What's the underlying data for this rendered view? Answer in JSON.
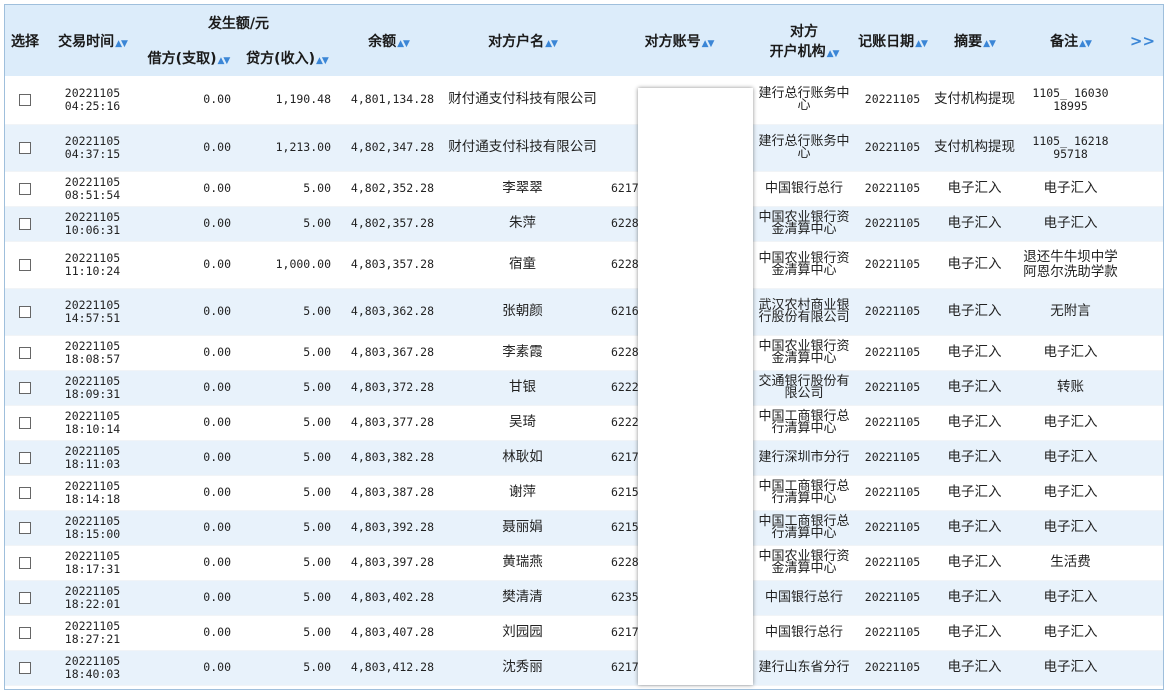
{
  "headers": {
    "select": "选择",
    "trans_time": "交易时间",
    "amount_group": "发生额/元",
    "debit": "借方(支取)",
    "credit": "贷方(收入)",
    "balance": "余额",
    "cp_name": "对方户名",
    "cp_account": "对方账号",
    "cp_bank_line1": "对方",
    "cp_bank_line2": "开户机构",
    "post_date": "记账日期",
    "summary": "摘要",
    "remark": "备注",
    "next_icon": "double-chevron-right-icon",
    "next_label": ">>",
    "sort_icon": "sort-arrows-icon",
    "sort_glyph": "▲▼"
  },
  "colors": {
    "header_bg": "#dcecfa",
    "stripe_bg": "#e8f2fb",
    "accent": "#3b86d6"
  },
  "rows": [
    {
      "date": "20221105",
      "time": "04:25:16",
      "debit": "0.00",
      "credit": "1,190.48",
      "balance": "4,801,134.28",
      "name": "财付通支付科技有限公司",
      "account": "",
      "bank": "建行总行账务中心",
      "post": "20221105",
      "summary": "支付机构提现",
      "remark": "1105_ 16030 18995"
    },
    {
      "date": "20221105",
      "time": "04:37:15",
      "debit": "0.00",
      "credit": "1,213.00",
      "balance": "4,802,347.28",
      "name": "财付通支付科技有限公司",
      "account": "",
      "bank": "建行总行账务中心",
      "post": "20221105",
      "summary": "支付机构提现",
      "remark": "1105_ 16218 95718"
    },
    {
      "date": "20221105",
      "time": "08:51:54",
      "debit": "0.00",
      "credit": "5.00",
      "balance": "4,802,352.28",
      "name": "李翠翠",
      "account": "6217",
      "bank": "中国银行总行",
      "post": "20221105",
      "summary": "电子汇入",
      "remark": "电子汇入"
    },
    {
      "date": "20221105",
      "time": "10:06:31",
      "debit": "0.00",
      "credit": "5.00",
      "balance": "4,802,357.28",
      "name": "朱萍",
      "account": "6228",
      "bank": "中国农业银行资金清算中心",
      "post": "20221105",
      "summary": "电子汇入",
      "remark": "电子汇入"
    },
    {
      "date": "20221105",
      "time": "11:10:24",
      "debit": "0.00",
      "credit": "1,000.00",
      "balance": "4,803,357.28",
      "name": "宿童",
      "account": "6228",
      "bank": "中国农业银行资金清算中心",
      "post": "20221105",
      "summary": "电子汇入",
      "remark": "退还牛牛坝中学阿恩尔洗助学款"
    },
    {
      "date": "20221105",
      "time": "14:57:51",
      "debit": "0.00",
      "credit": "5.00",
      "balance": "4,803,362.28",
      "name": "张朝颜",
      "account": "6216",
      "bank": "武汉农村商业银行股份有限公司",
      "post": "20221105",
      "summary": "电子汇入",
      "remark": "无附言"
    },
    {
      "date": "20221105",
      "time": "18:08:57",
      "debit": "0.00",
      "credit": "5.00",
      "balance": "4,803,367.28",
      "name": "李素霞",
      "account": "6228",
      "bank": "中国农业银行资金清算中心",
      "post": "20221105",
      "summary": "电子汇入",
      "remark": "电子汇入"
    },
    {
      "date": "20221105",
      "time": "18:09:31",
      "debit": "0.00",
      "credit": "5.00",
      "balance": "4,803,372.28",
      "name": "甘银",
      "account": "6222",
      "bank": "交通银行股份有限公司",
      "post": "20221105",
      "summary": "电子汇入",
      "remark": "转账"
    },
    {
      "date": "20221105",
      "time": "18:10:14",
      "debit": "0.00",
      "credit": "5.00",
      "balance": "4,803,377.28",
      "name": "吴琦",
      "account": "6222",
      "bank": "中国工商银行总行清算中心",
      "post": "20221105",
      "summary": "电子汇入",
      "remark": "电子汇入"
    },
    {
      "date": "20221105",
      "time": "18:11:03",
      "debit": "0.00",
      "credit": "5.00",
      "balance": "4,803,382.28",
      "name": "林耿如",
      "account": "6217",
      "bank": "建行深圳市分行",
      "post": "20221105",
      "summary": "电子汇入",
      "remark": "电子汇入"
    },
    {
      "date": "20221105",
      "time": "18:14:18",
      "debit": "0.00",
      "credit": "5.00",
      "balance": "4,803,387.28",
      "name": "谢萍",
      "account": "6215",
      "bank": "中国工商银行总行清算中心",
      "post": "20221105",
      "summary": "电子汇入",
      "remark": "电子汇入"
    },
    {
      "date": "20221105",
      "time": "18:15:00",
      "debit": "0.00",
      "credit": "5.00",
      "balance": "4,803,392.28",
      "name": "聂丽娟",
      "account": "6215",
      "bank": "中国工商银行总行清算中心",
      "post": "20221105",
      "summary": "电子汇入",
      "remark": "电子汇入"
    },
    {
      "date": "20221105",
      "time": "18:17:31",
      "debit": "0.00",
      "credit": "5.00",
      "balance": "4,803,397.28",
      "name": "黄瑞燕",
      "account": "6228",
      "bank": "中国农业银行资金清算中心",
      "post": "20221105",
      "summary": "电子汇入",
      "remark": "生活费"
    },
    {
      "date": "20221105",
      "time": "18:22:01",
      "debit": "0.00",
      "credit": "5.00",
      "balance": "4,803,402.28",
      "name": "樊清清",
      "account": "6235",
      "bank": "中国银行总行",
      "post": "20221105",
      "summary": "电子汇入",
      "remark": "电子汇入"
    },
    {
      "date": "20221105",
      "time": "18:27:21",
      "debit": "0.00",
      "credit": "5.00",
      "balance": "4,803,407.28",
      "name": "刘园园",
      "account": "6217",
      "bank": "中国银行总行",
      "post": "20221105",
      "summary": "电子汇入",
      "remark": "电子汇入"
    },
    {
      "date": "20221105",
      "time": "18:40:03",
      "debit": "0.00",
      "credit": "5.00",
      "balance": "4,803,412.28",
      "name": "沈秀丽",
      "account": "6217",
      "bank": "建行山东省分行",
      "post": "20221105",
      "summary": "电子汇入",
      "remark": "电子汇入"
    }
  ]
}
